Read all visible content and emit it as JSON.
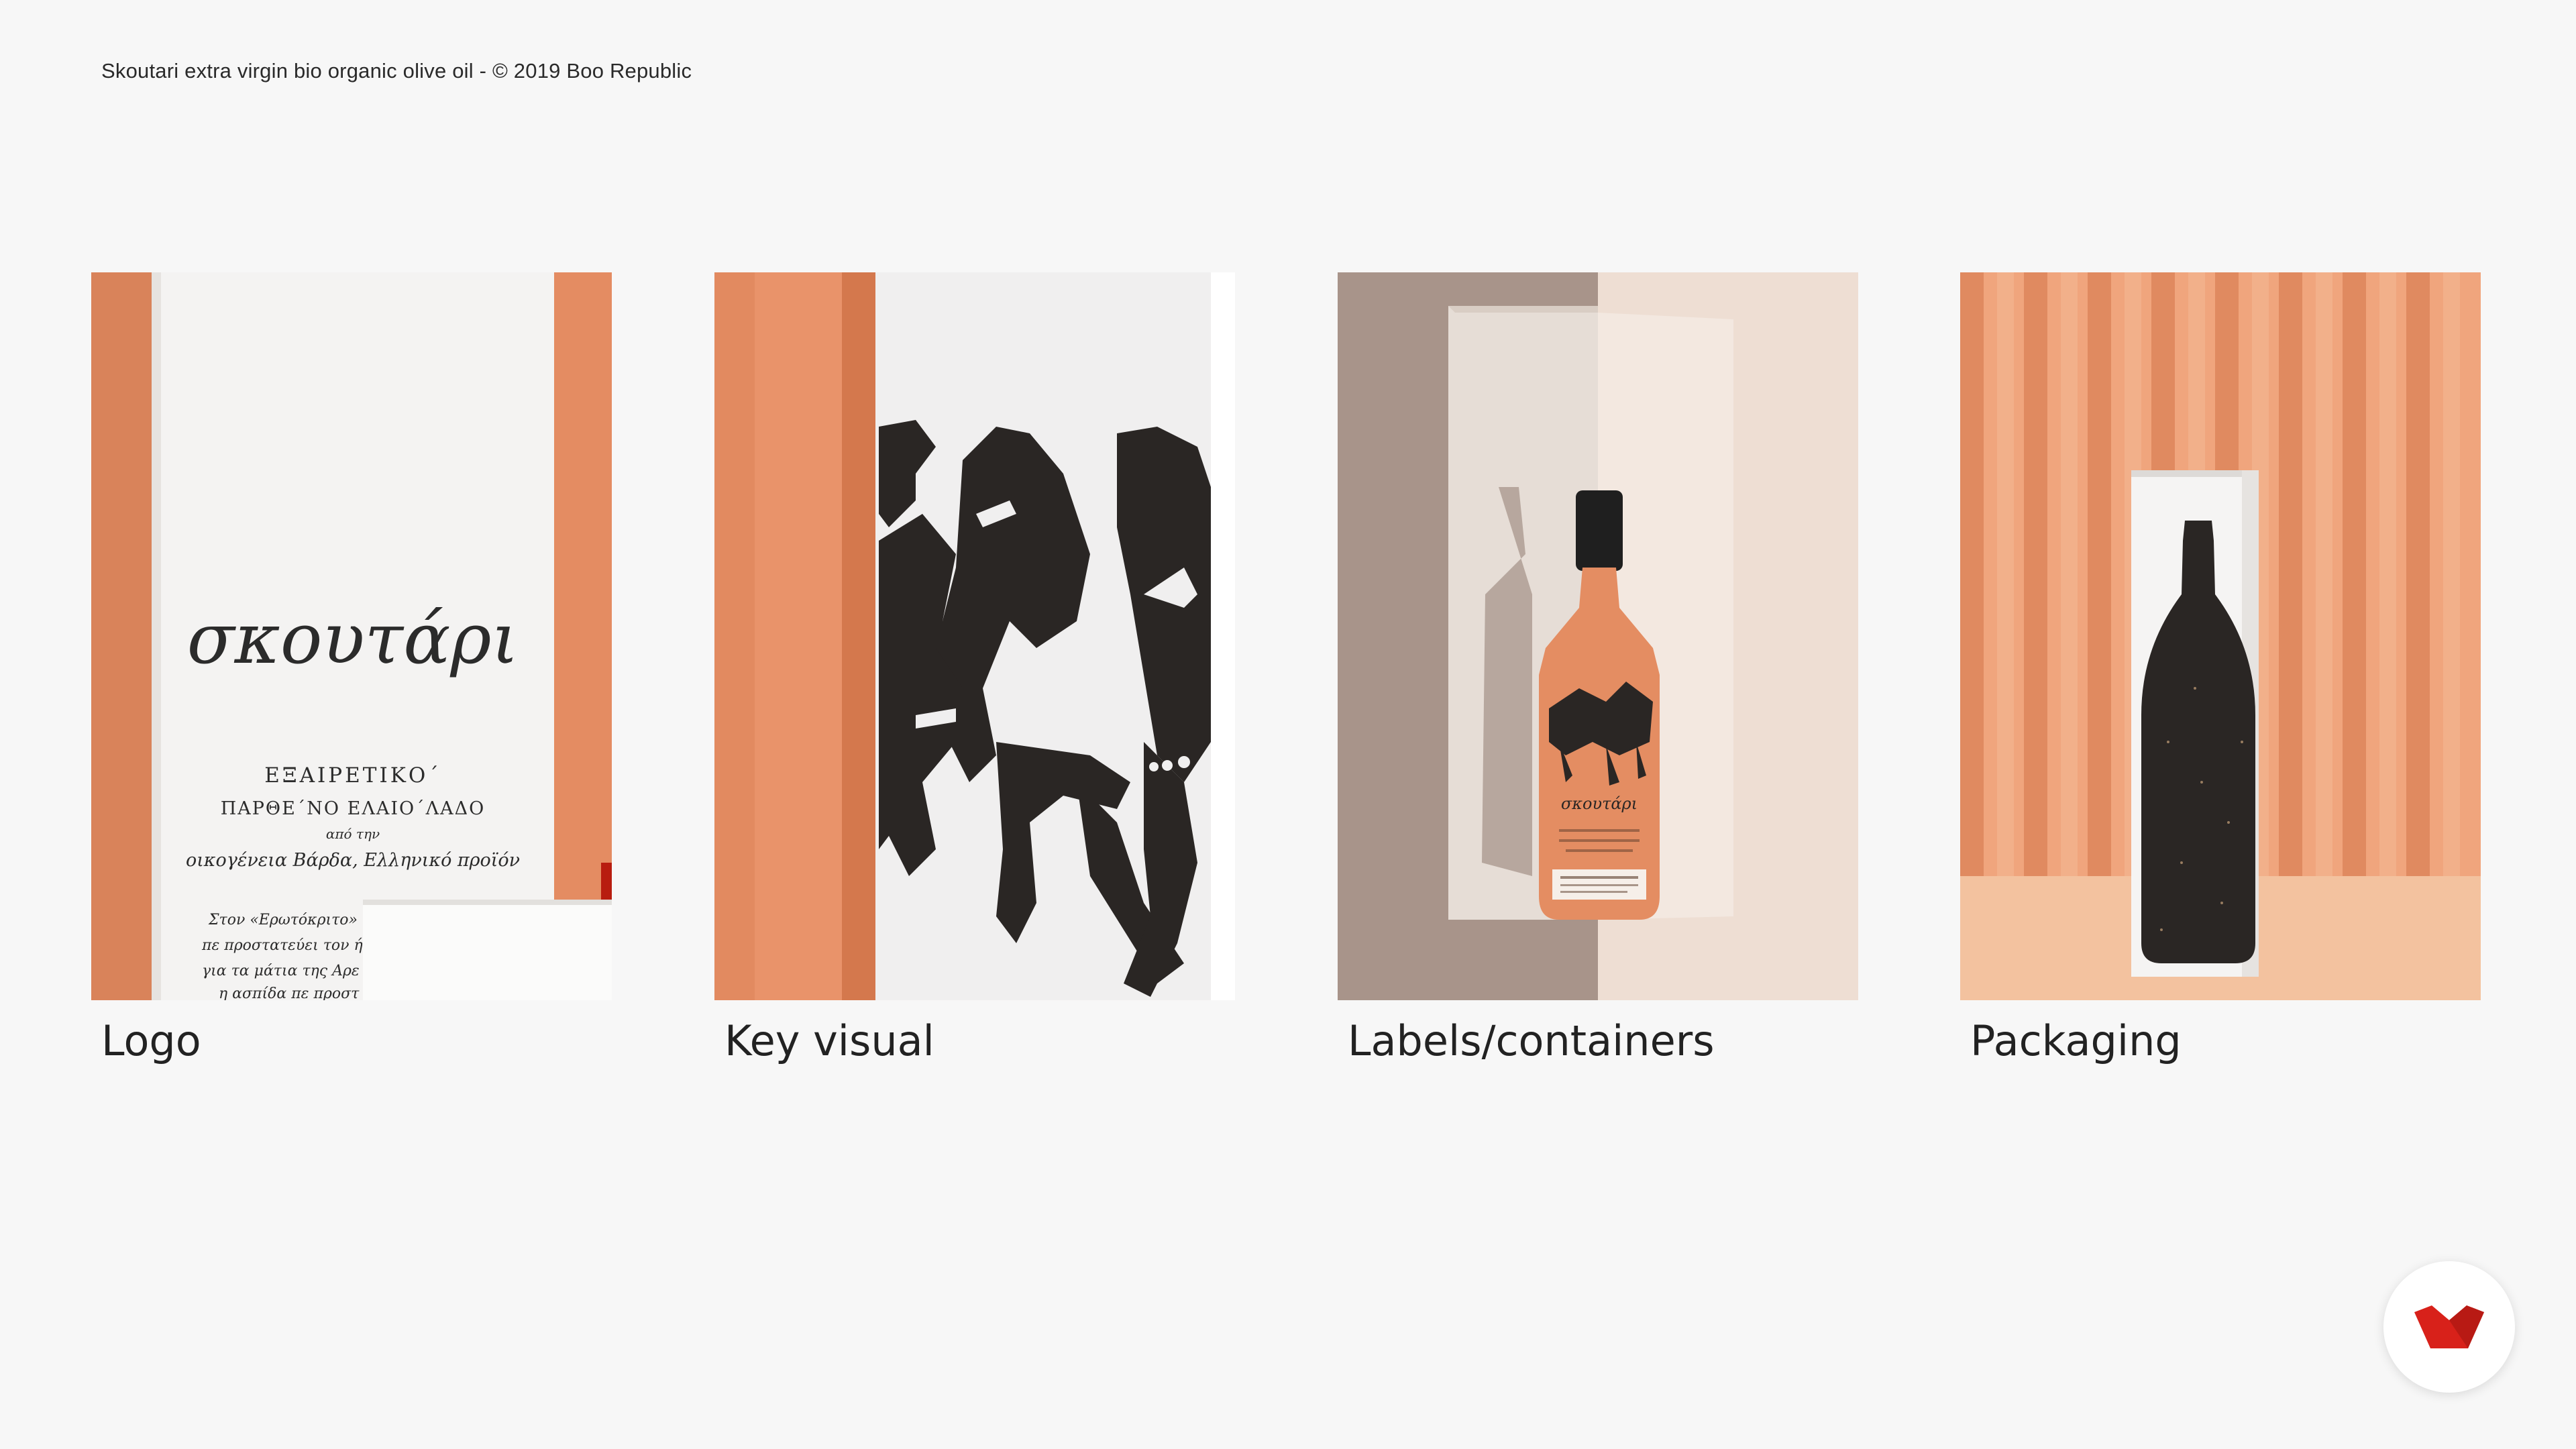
{
  "credit": "Skoutari extra virgin bio organic olive oil - © 2019 Boo Republic",
  "cards": [
    {
      "label": "Logo",
      "logo_word": "σκουτάρι",
      "line1": "ΕΞΑΙΡΕΤΙΚΟ΄",
      "line2": "ΠΑΡΘΕ΄ΝΟ ΕΛΑΙΟ΄ΛΑΔΟ",
      "line3": "από την",
      "line4": "οικογένεια Βάρδα, Ελληνικό προϊόν",
      "poem1": "Στον «Ερωτόκριτο»",
      "poem2": "πε προστατεύει τον ή",
      "poem3": "για τα μάτια της Αρε",
      "poem4": "η ασπίδα πε προστ"
    },
    {
      "label": "Key visual"
    },
    {
      "label": "Labels/containers"
    },
    {
      "label": "Packaging"
    }
  ],
  "colors": {
    "orange": "#e9936a",
    "orange_dark": "#d9835a",
    "background": "#f7f7f7",
    "brand_red": "#d8211a"
  },
  "fab_icon": "brand-logo-icon"
}
